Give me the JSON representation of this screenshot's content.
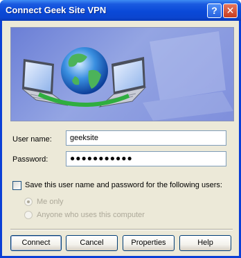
{
  "window": {
    "title": "Connect Geek Site VPN",
    "help_button": "?",
    "close_button": "✕"
  },
  "form": {
    "username_label": "User name:",
    "username_value": "geeksite",
    "password_label": "Password:",
    "password_value": "●●●●●●●●●●●",
    "save_checkbox_label": "Save this user name and password for the following users:",
    "save_checked": false,
    "radio_me_only": "Me only",
    "radio_anyone": "Anyone who uses this computer",
    "selected_radio": "me_only"
  },
  "buttons": {
    "connect": "Connect",
    "cancel": "Cancel",
    "properties": "Properties",
    "help": "Help"
  },
  "colors": {
    "title_bar": "#0a49d8",
    "dialog_bg": "#ece9d8",
    "banner": "#7f8fdc",
    "close_button": "#c73c1f"
  },
  "icons": [
    "globe-icon",
    "laptop-icon",
    "help-icon",
    "close-icon"
  ]
}
